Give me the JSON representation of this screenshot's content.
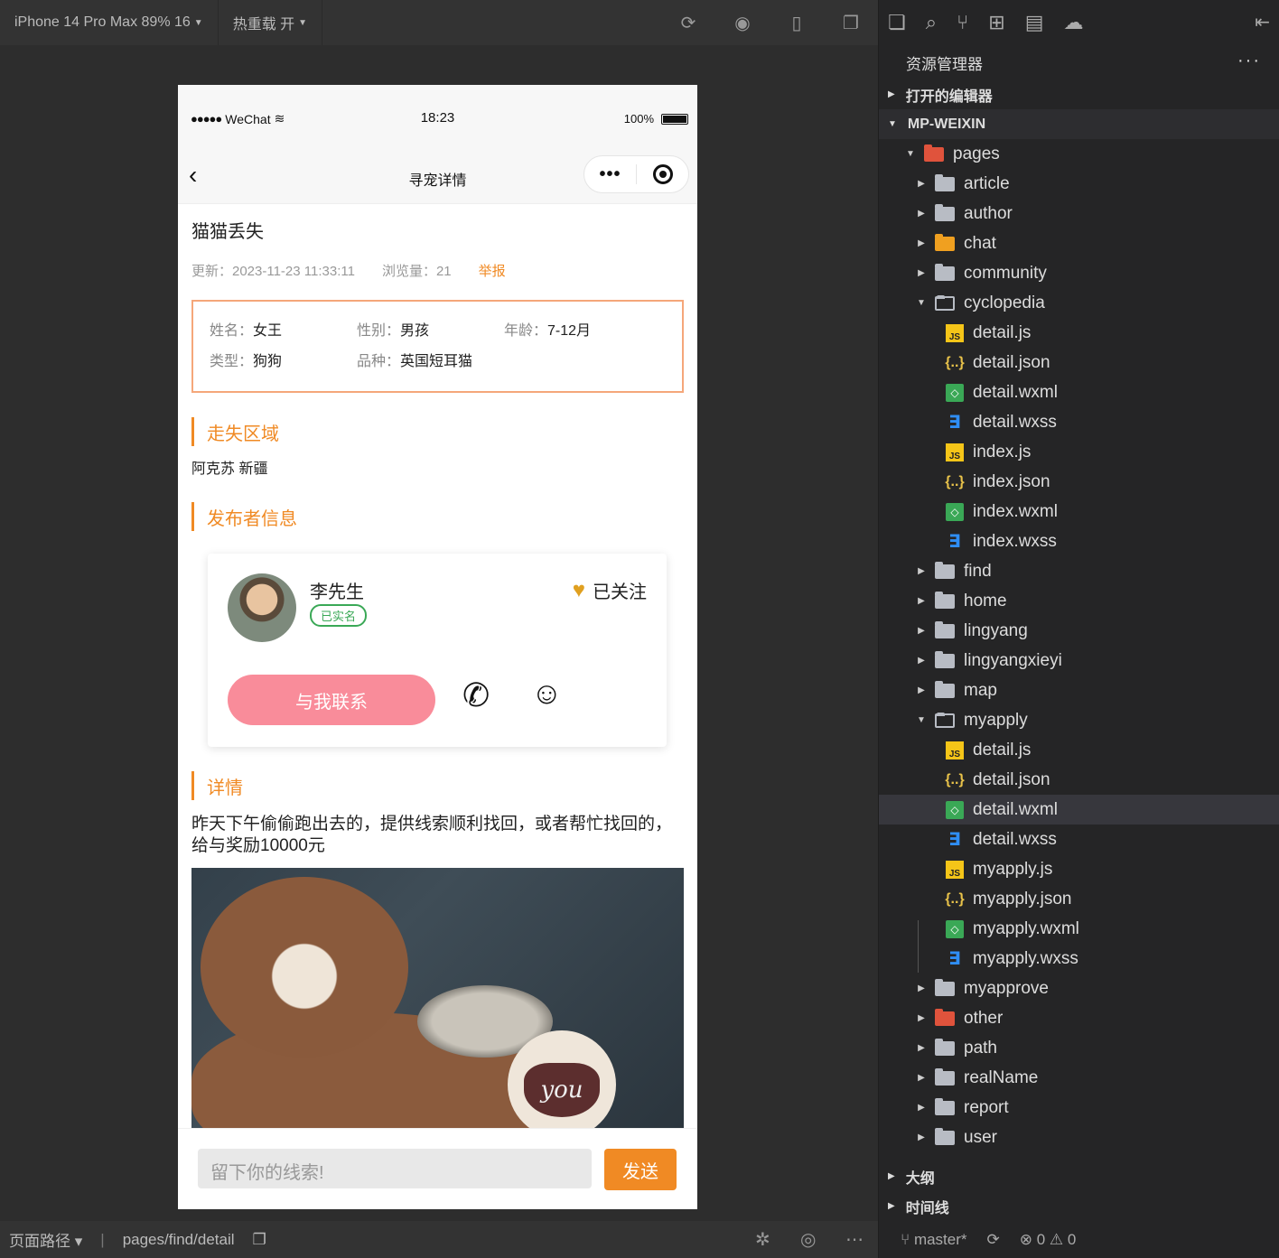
{
  "toolbar": {
    "device": "iPhone 14 Pro Max 89% 16",
    "reload": "热重载 开"
  },
  "status": {
    "carrier": "WeChat",
    "time": "18:23",
    "battery": "100%"
  },
  "nav": {
    "title": "寻宠详情"
  },
  "page": {
    "title": "猫猫丢失",
    "updated": "更新：2023-11-23 11:33:11",
    "views": "浏览量：21",
    "report": "举报",
    "info": {
      "name_k": "姓名：",
      "name_v": "女王",
      "gender_k": "性别：",
      "gender_v": "男孩",
      "age_k": "年龄：",
      "age_v": "7-12月",
      "type_k": "类型：",
      "type_v": "狗狗",
      "breed_k": "品种：",
      "breed_v": "英国短耳猫"
    },
    "sec_area": "走失区域",
    "area": "阿克苏 新疆",
    "sec_pub": "发布者信息",
    "publisher": {
      "name": "李先生",
      "verified": "已实名",
      "follow": "已关注",
      "contact": "与我联系"
    },
    "sec_detail": "详情",
    "detail": "昨天下午偷偷跑出去的，提供线索顺利找回，或者帮忙找回的，给与奖励10000元",
    "input_placeholder": "留下你的线索!",
    "send": "发送"
  },
  "footer": {
    "path_label": "页面路径",
    "path": "pages/find/detail"
  },
  "explorer": {
    "title": "资源管理器",
    "open_editors": "打开的编辑器",
    "project": "MP-WEIXIN",
    "outline": "大纲",
    "timeline": "时间线",
    "branch": "master*",
    "errors": "0",
    "warnings": "0",
    "tree": [
      {
        "label": "pages"
      },
      {
        "label": "article"
      },
      {
        "label": "author"
      },
      {
        "label": "chat"
      },
      {
        "label": "community"
      },
      {
        "label": "cyclopedia"
      },
      {
        "label": "detail.js"
      },
      {
        "label": "detail.json"
      },
      {
        "label": "detail.wxml"
      },
      {
        "label": "detail.wxss"
      },
      {
        "label": "index.js"
      },
      {
        "label": "index.json"
      },
      {
        "label": "index.wxml"
      },
      {
        "label": "index.wxss"
      },
      {
        "label": "find"
      },
      {
        "label": "home"
      },
      {
        "label": "lingyang"
      },
      {
        "label": "lingyangxieyi"
      },
      {
        "label": "map"
      },
      {
        "label": "myapply"
      },
      {
        "label": "detail.js"
      },
      {
        "label": "detail.json"
      },
      {
        "label": "detail.wxml"
      },
      {
        "label": "detail.wxss"
      },
      {
        "label": "myapply.js"
      },
      {
        "label": "myapply.json"
      },
      {
        "label": "myapply.wxml"
      },
      {
        "label": "myapply.wxss"
      },
      {
        "label": "myapprove"
      },
      {
        "label": "other"
      },
      {
        "label": "path"
      },
      {
        "label": "realName"
      },
      {
        "label": "report"
      },
      {
        "label": "user"
      }
    ]
  }
}
